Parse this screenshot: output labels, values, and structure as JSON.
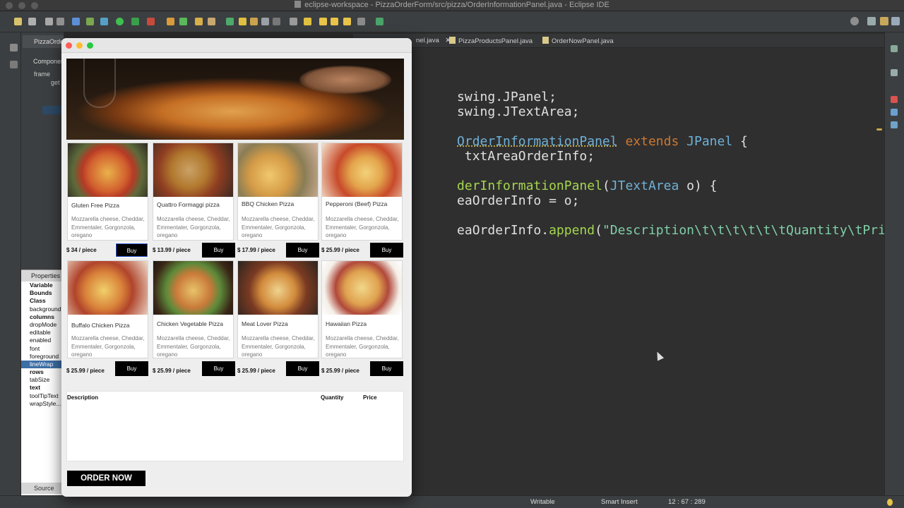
{
  "window": {
    "title": "eclipse-workspace - PizzaOrderForm/src/pizza/OrderInformationPanel.java - Eclipse IDE"
  },
  "palette": {
    "tab_label": "PizzaOrder",
    "components_label": "Componen",
    "frame_label": "frame",
    "getter_label": "get"
  },
  "properties": {
    "title": "Properties",
    "rows": [
      "Variable",
      "Bounds",
      "Class",
      "background",
      "columns",
      "dropMode",
      "editable",
      "enabled",
      "font",
      "foreground",
      "lineWrap",
      "rows",
      "tabSize",
      "text",
      "toolTipText",
      "wrapStyle..."
    ],
    "bold_rows": [
      "Variable",
      "Bounds",
      "Class",
      "columns",
      "rows",
      "text"
    ],
    "selected_row": "lineWrap"
  },
  "source_tab": "Source",
  "editor": {
    "tabs": [
      {
        "label": "nel.java",
        "closable": true
      },
      {
        "label": "PizzaProductsPanel.java",
        "closable": false
      },
      {
        "label": "OrderNowPanel.java",
        "closable": false
      }
    ],
    "code": {
      "l1": "swing.JPanel;",
      "l2": "swing.JTextArea;",
      "l3_class": "OrderInformationPanel",
      "l3_extends": "extends",
      "l3_type": "JPanel",
      "l3_brace": " {",
      "l4": " txtAreaOrderInfo;",
      "l5_ctor": "derInformationPanel",
      "l5_paren": "(",
      "l5_type": "JTextArea",
      "l5_rest": " o) {",
      "l6": "eaOrderInfo = o;",
      "l7_obj": "eaOrderInfo.",
      "l7_method": "append",
      "l7_open": "(",
      "l7_str": "\"Description\\t\\t\\t\\t\\t\\tQuantity\\tPrice\"",
      "l7_close": ");"
    }
  },
  "status": {
    "writable": "Writable",
    "insert_mode": "Smart Insert",
    "position": "12 : 67 : 289"
  },
  "app": {
    "products": [
      {
        "name": "Gluten Free Pizza",
        "desc": "Mozzarella cheese, Cheddar, Emmentaler, Gorgonzola, oregano",
        "price": "$ 34 / piece",
        "buy": "Buy",
        "photo": "gluten-free"
      },
      {
        "name": "Quattro Formaggi pizza",
        "desc": "Mozzarella cheese, Cheddar, Emmentaler, Gorgonzola, oregano",
        "price": "$ 13.99 / piece",
        "buy": "Buy",
        "photo": "quattro"
      },
      {
        "name": "BBQ Chicken Pizza",
        "desc": "Mozzarella cheese, Cheddar, Emmentaler, Gorgonzola, oregano",
        "price": "$ 17.99 / piece",
        "buy": "Buy",
        "photo": "bbq"
      },
      {
        "name": "Pepperoni (Beef) Pizza",
        "desc": "Mozzarella cheese, Cheddar, Emmentaler, Gorgonzola, oregano",
        "price": "$ 25.99 / piece",
        "buy": "Buy",
        "photo": "pepperoni"
      },
      {
        "name": "Buffalo Chicken Pizza",
        "desc": "Mozzarella cheese, Cheddar, Emmentaler, Gorgonzola, oregano",
        "price": "$ 25.99 / piece",
        "buy": "Buy",
        "photo": "buffalo"
      },
      {
        "name": "Chicken Vegetable Pizza",
        "desc": "Mozzarella cheese, Cheddar, Emmentaler, Gorgonzola, oregano",
        "price": "$ 25.99 / piece",
        "buy": "Buy",
        "photo": "chicken-veg"
      },
      {
        "name": "Meat Lover Pizza",
        "desc": "Mozzarella cheese, Cheddar, Emmentaler, Gorgonzola, oregano",
        "price": "$ 25.99 / piece",
        "buy": "Buy",
        "photo": "meat-lover"
      },
      {
        "name": "Hawaiian Pizza",
        "desc": "Mozzarella cheese, Cheddar, Emmentaler, Gorgonzola, oregano",
        "price": "$ 25.99 / piece",
        "buy": "Buy",
        "photo": "hawaiian"
      }
    ],
    "order": {
      "col_description": "Description",
      "col_quantity": "Quantity",
      "col_price": "Price"
    },
    "order_button": "ORDER NOW"
  },
  "colors": {
    "editor_bg": "#2f2f2f",
    "keyword": "#cc7832",
    "type": "#6fb1d9",
    "method": "#a5d64e",
    "string": "#7fcfa8",
    "buy_button": "#000000",
    "selected_property": "#3d6ea5"
  }
}
